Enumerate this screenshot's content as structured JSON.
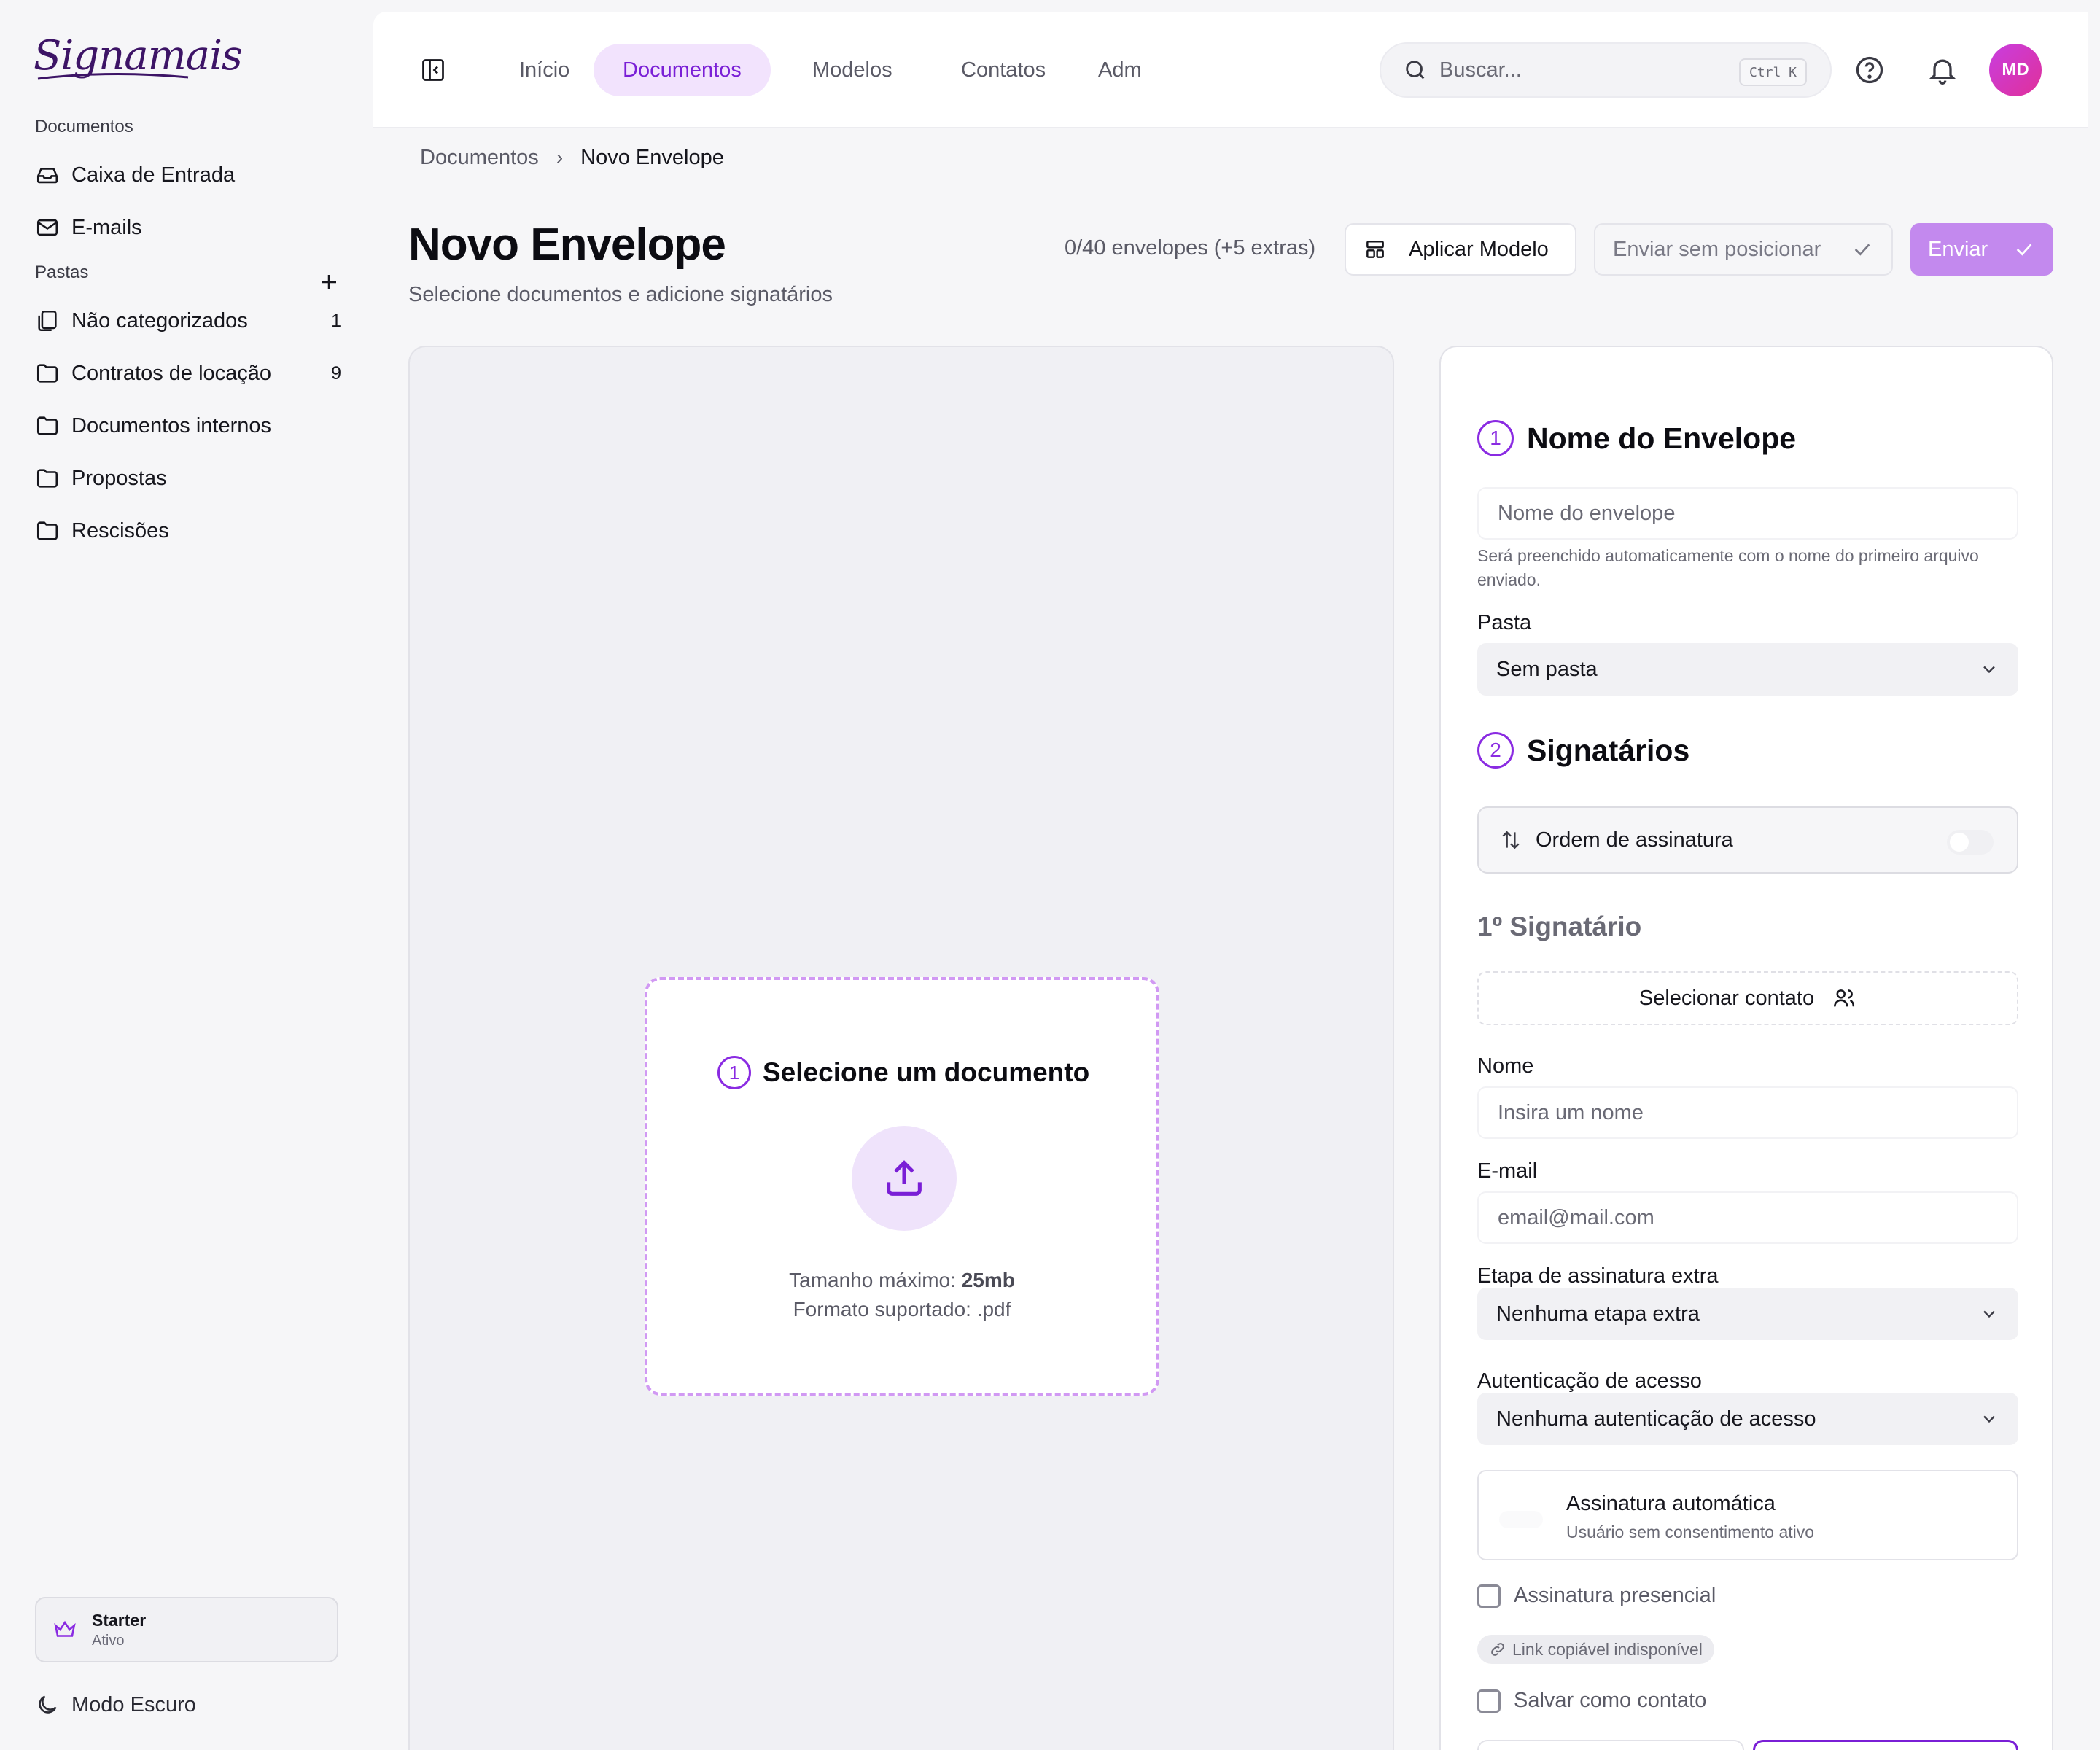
{
  "app": {
    "brand": "Signamais"
  },
  "sidebar": {
    "section_documents": "Documentos",
    "items": [
      {
        "label": "Caixa de Entrada",
        "icon": "inbox-icon"
      },
      {
        "label": "E-mails",
        "icon": "mail-icon"
      }
    ],
    "section_folders": "Pastas",
    "folders": [
      {
        "label": "Não categorizados",
        "count": "1",
        "icon": "files-icon"
      },
      {
        "label": "Contratos de locação",
        "count": "9",
        "icon": "folder-icon"
      },
      {
        "label": "Documentos internos",
        "count": "",
        "icon": "folder-icon"
      },
      {
        "label": "Propostas",
        "count": "",
        "icon": "folder-icon"
      },
      {
        "label": "Rescisões",
        "count": "",
        "icon": "folder-icon"
      }
    ],
    "plan": {
      "name": "Starter",
      "status": "Ativo"
    },
    "dark_mode_label": "Modo Escuro"
  },
  "topbar": {
    "tabs": [
      {
        "label": "Início",
        "active": false
      },
      {
        "label": "Documentos",
        "active": true
      },
      {
        "label": "Modelos",
        "active": false
      },
      {
        "label": "Contatos",
        "active": false
      },
      {
        "label": "Adm",
        "active": false
      }
    ],
    "search": {
      "placeholder": "Buscar...",
      "shortcut": "Ctrl K"
    },
    "avatar_initials": "MD"
  },
  "breadcrumb": {
    "parent": "Documentos",
    "current": "Novo Envelope"
  },
  "page": {
    "title": "Novo Envelope",
    "subtitle": "Selecione documentos e adicione signatários",
    "envelope_count": "0/40 envelopes (+5 extras)",
    "apply_template_label": "Aplicar Modelo",
    "send_without_positioning_label": "Enviar sem posicionar",
    "send_label": "Enviar"
  },
  "upload": {
    "step": "1",
    "heading": "Selecione um documento",
    "max_size_label": "Tamanho máximo:",
    "max_size_value": "25mb",
    "format_label": "Formato suportado: .pdf"
  },
  "form": {
    "envelope_step": "1",
    "envelope_heading": "Nome do Envelope",
    "envelope_name_placeholder": "Nome do envelope",
    "envelope_name_hint": "Será preenchido automaticamente com o nome do primeiro arquivo enviado.",
    "folder_label": "Pasta",
    "folder_value": "Sem pasta",
    "signers_step": "2",
    "signers_heading": "Signatários",
    "signing_order_label": "Ordem de assinatura",
    "signing_order_enabled": false,
    "signer_title": "1º Signatário",
    "select_contact_label": "Selecionar contato",
    "name_label": "Nome",
    "name_placeholder": "Insira um nome",
    "email_label": "E-mail",
    "email_placeholder": "email@mail.com",
    "extra_step_label": "Etapa de assinatura extra",
    "extra_step_value": "Nenhuma etapa extra",
    "auth_label": "Autenticação de acesso",
    "auth_value": "Nenhuma autenticação de acesso",
    "auto_sign_title": "Assinatura automática",
    "auto_sign_subtitle": "Usuário sem consentimento ativo",
    "in_person_label": "Assinatura presencial",
    "copy_link_label": "Link copiável indisponível",
    "save_contact_label": "Salvar como contato"
  },
  "colors": {
    "accent": "#8a2be2",
    "accent_light": "#f2e3fd",
    "send_button": "#c389ee",
    "dropzone_border": "#d199f3"
  }
}
